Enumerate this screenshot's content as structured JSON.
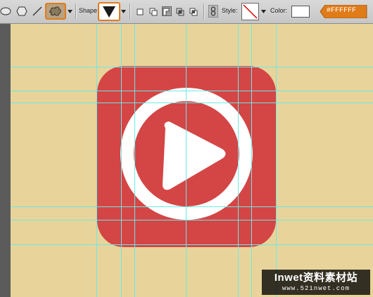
{
  "toolbar": {
    "shape_label": "Shape",
    "style_label": "Style:",
    "color_label": "Color:",
    "color_value": "#FFFFFF",
    "color_hex": "#FFFFFF",
    "accent": "#e07b1a"
  },
  "icons": {
    "ellipse": "ellipse-tool-icon",
    "polygon": "polygon-tool-icon",
    "line": "line-tool-icon",
    "custom_shape": "custom-shape-tool-icon",
    "shape_preset": "triangle-shape-icon",
    "link": "link-icon",
    "style": "no-style-icon"
  },
  "document": {
    "background": "#e8d49a",
    "app_icon_color": "#d44545",
    "circle_color": "#ffffff",
    "guide_color": "#6ce8e6"
  },
  "watermark": {
    "title": "Inwet资料素材站",
    "url": "www.52inwet.com"
  }
}
